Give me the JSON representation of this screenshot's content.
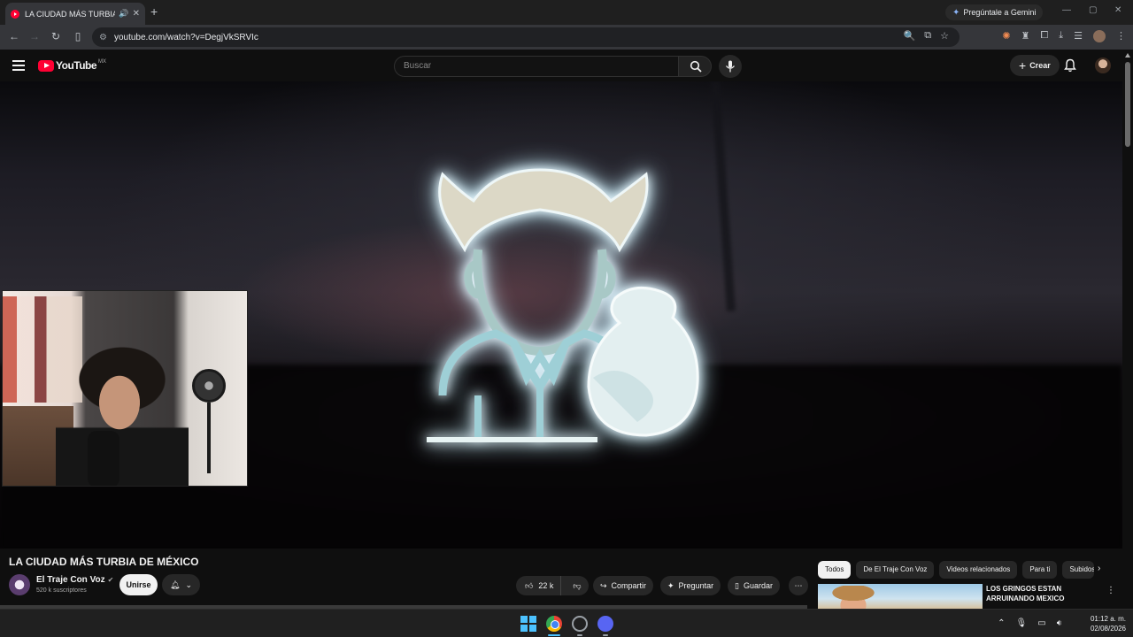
{
  "browser": {
    "tab_title": "LA CIUDAD MÁS TURBIA DE MÉXICO - YouTube",
    "new_tab": "+",
    "gemini_label": "Pregúntale a Gemini",
    "url": "youtube.com/watch?v=DegjVkSRVIc"
  },
  "youtube": {
    "logo_text": "YouTube",
    "country_code": "MX",
    "search_placeholder": "Buscar",
    "create_label": "Crear"
  },
  "video": {
    "title": "LA CIUDAD MÁS TURBIA DE MÉXICO",
    "channel": {
      "name": "El Traje Con Voz",
      "subscribers": "520 k suscriptores",
      "join_label": "Unirse"
    },
    "actions": {
      "likes": "22 k",
      "share": "Compartir",
      "ask": "Preguntar",
      "save": "Guardar"
    }
  },
  "related": {
    "chips": [
      "Todos",
      "De El Traje Con Voz",
      "Videos relacionados",
      "Para ti",
      "Subidos"
    ],
    "active_chip": "Todos",
    "first_title": "LOS GRINGOS ESTAN ARRUINANDO MEXICO"
  },
  "taskbar": {
    "time": "01:12 a. m.",
    "date": "02/08/2026"
  },
  "colors": {
    "youtube_red": "#ff0033",
    "background": "#0f0f0f",
    "windows_blue": "#4cc2ff",
    "discord": "#5865f2"
  },
  "icons": [
    "menu-icon",
    "search-icon",
    "mic-icon",
    "bell-icon",
    "like-icon",
    "dislike-icon",
    "share-icon",
    "sparkle-icon",
    "bookmark-icon",
    "more-icon"
  ]
}
